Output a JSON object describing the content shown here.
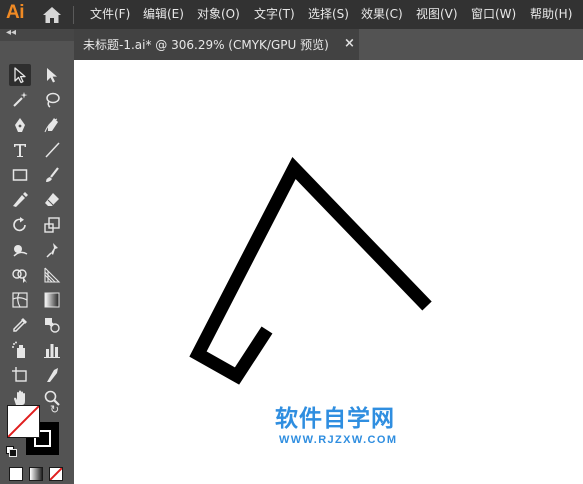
{
  "app": {
    "logo": "Ai"
  },
  "menu": [
    {
      "label": "文件(F)"
    },
    {
      "label": "编辑(E)"
    },
    {
      "label": "对象(O)"
    },
    {
      "label": "文字(T)"
    },
    {
      "label": "选择(S)"
    },
    {
      "label": "效果(C)"
    },
    {
      "label": "视图(V)"
    },
    {
      "label": "窗口(W)"
    },
    {
      "label": "帮助(H)"
    }
  ],
  "panel": {
    "collapse": "◂◂"
  },
  "tab": {
    "title": "未标题-1.ai* @ 306.29% (CMYK/GPU 预览)",
    "close": "×"
  },
  "tools": [
    {
      "icon": "selection-tool-icon"
    },
    {
      "icon": "direct-selection-tool-icon"
    },
    {
      "icon": "magic-wand-tool-icon"
    },
    {
      "icon": "lasso-tool-icon"
    },
    {
      "icon": "pen-tool-icon"
    },
    {
      "icon": "curvature-tool-icon"
    },
    {
      "icon": "type-tool-icon"
    },
    {
      "icon": "line-segment-tool-icon"
    },
    {
      "icon": "rectangle-tool-icon"
    },
    {
      "icon": "paintbrush-tool-icon"
    },
    {
      "icon": "shaper-tool-icon"
    },
    {
      "icon": "eraser-tool-icon"
    },
    {
      "icon": "rotate-tool-icon"
    },
    {
      "icon": "scale-tool-icon"
    },
    {
      "icon": "warp-tool-icon"
    },
    {
      "icon": "puppet-warp-tool-icon"
    },
    {
      "icon": "shape-builder-tool-icon"
    },
    {
      "icon": "perspective-grid-tool-icon"
    },
    {
      "icon": "mesh-tool-icon"
    },
    {
      "icon": "gradient-tool-icon"
    },
    {
      "icon": "eyedropper-tool-icon"
    },
    {
      "icon": "blend-tool-icon"
    },
    {
      "icon": "symbol-sprayer-tool-icon"
    },
    {
      "icon": "column-graph-tool-icon"
    },
    {
      "icon": "artboard-tool-icon"
    },
    {
      "icon": "slice-tool-icon"
    },
    {
      "icon": "hand-tool-icon"
    },
    {
      "icon": "zoom-tool-icon"
    }
  ],
  "colors": {
    "fill": "none",
    "stroke": "#000000",
    "accent": "#f08a24"
  },
  "watermark": {
    "text": "软件自学网",
    "url": "WWW.RJZXW.COM"
  }
}
